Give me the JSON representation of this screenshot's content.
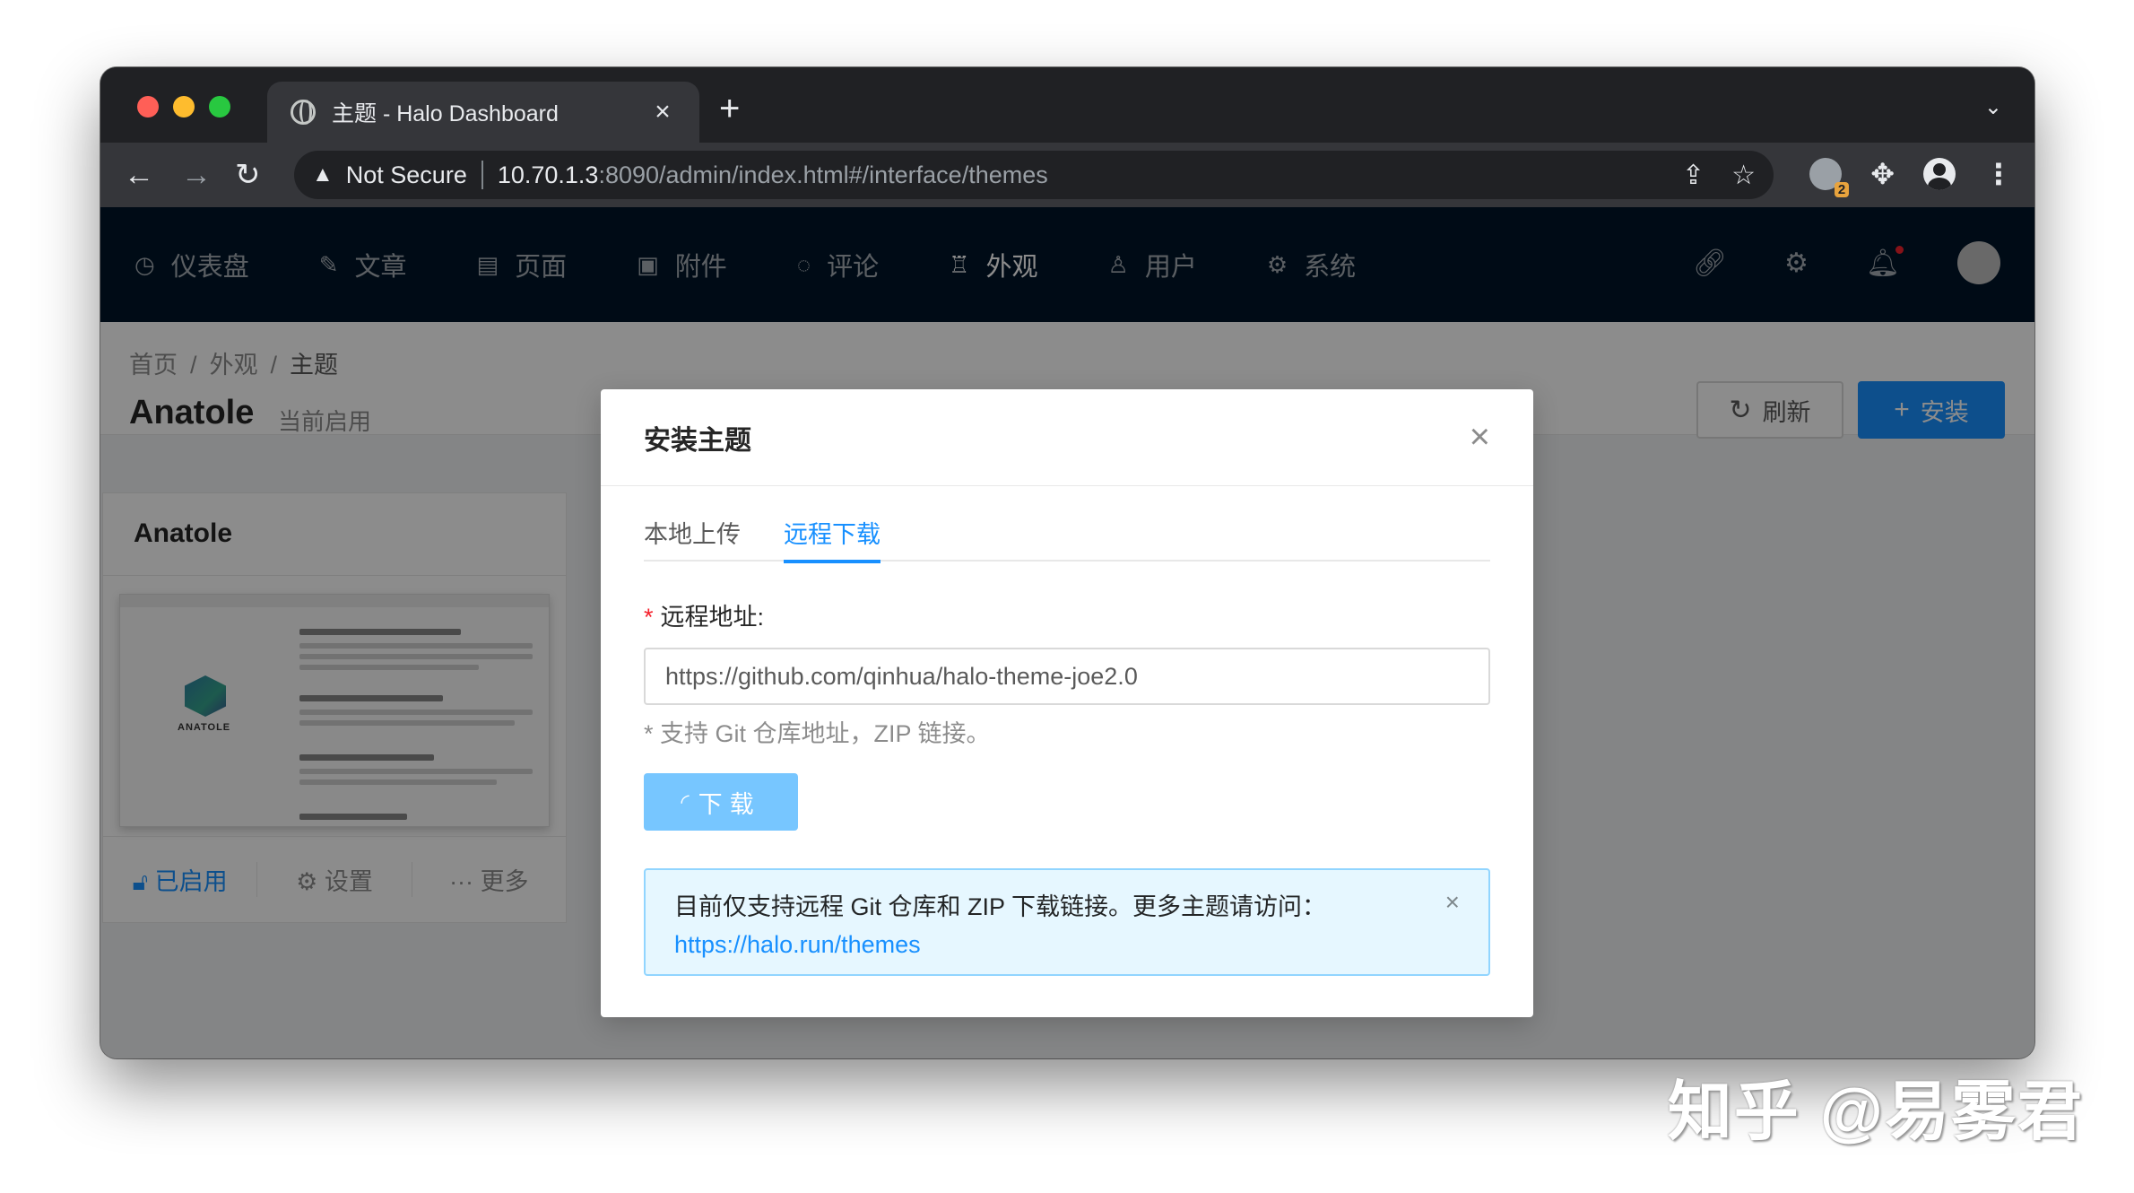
{
  "browser": {
    "tab_title": "主题 - Halo Dashboard",
    "tab_close": "×",
    "new_tab": "+",
    "security_label": "Not Secure",
    "url_host": "10.70.1.3",
    "url_path": ":8090/admin/index.html#/interface/themes",
    "extension_badge": "2"
  },
  "app_nav": {
    "items": [
      {
        "label": "仪表盘",
        "icon": "dashboard-icon"
      },
      {
        "label": "文章",
        "icon": "edit-icon"
      },
      {
        "label": "页面",
        "icon": "book-icon"
      },
      {
        "label": "附件",
        "icon": "picture-icon"
      },
      {
        "label": "评论",
        "icon": "comment-icon"
      },
      {
        "label": "外观",
        "icon": "skin-icon",
        "active": true
      },
      {
        "label": "用户",
        "icon": "user-icon"
      },
      {
        "label": "系统",
        "icon": "setting-icon"
      }
    ]
  },
  "page_header": {
    "breadcrumb": [
      "首页",
      "外观",
      "主题"
    ],
    "breadcrumb_sep": "/",
    "title": "Anatole",
    "subtitle": "当前启用",
    "refresh_label": "刷新",
    "install_label": "安装"
  },
  "theme_card": {
    "title": "Anatole",
    "cover_logo_text": "ANATOLE",
    "actions": {
      "enabled": "已启用",
      "settings": "设置",
      "more": "更多"
    }
  },
  "modal": {
    "title": "安装主题",
    "tabs": [
      {
        "label": "本地上传"
      },
      {
        "label": "远程下载",
        "active": true
      }
    ],
    "field_label": "远程地址:",
    "required_mark": "*",
    "url_value": "https://github.com/qinhua/halo-theme-joe2.0",
    "hint": "* 支持 Git 仓库地址，ZIP 链接。",
    "download_label": "下载",
    "alert_text": "目前仅支持远程 Git 仓库和 ZIP 下载链接。更多主题请访问：",
    "alert_link": "https://halo.run/themes"
  },
  "watermark": "知乎 @易雾君",
  "colors": {
    "primary": "#1890ff",
    "nav_bg": "#001529",
    "alert_bg": "#e6f7ff",
    "required": "#f5222d"
  }
}
